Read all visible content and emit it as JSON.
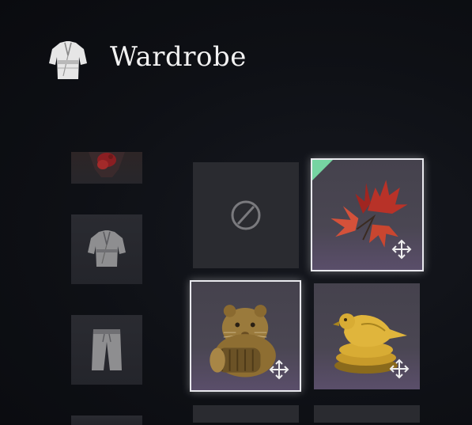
{
  "header": {
    "title": "Wardrobe",
    "icon": "robe-icon"
  },
  "categories": [
    {
      "name": "armor-category",
      "icon": "armor-icon"
    },
    {
      "name": "robe-category",
      "icon": "robe-icon"
    },
    {
      "name": "pants-category",
      "icon": "pants-icon"
    },
    {
      "name": "extra-category",
      "icon": ""
    }
  ],
  "slots": [
    {
      "kind": "empty",
      "icon": "none-icon"
    },
    {
      "kind": "item",
      "icon": "maple-leaves-icon",
      "new": true,
      "selected": true
    },
    {
      "kind": "item",
      "icon": "golden-hamster-icon",
      "selected": true
    },
    {
      "kind": "item",
      "icon": "golden-bird-icon",
      "selected": false
    }
  ],
  "colors": {
    "new_tag": "#76d4a2",
    "selected_border": "#e9e9ee"
  }
}
